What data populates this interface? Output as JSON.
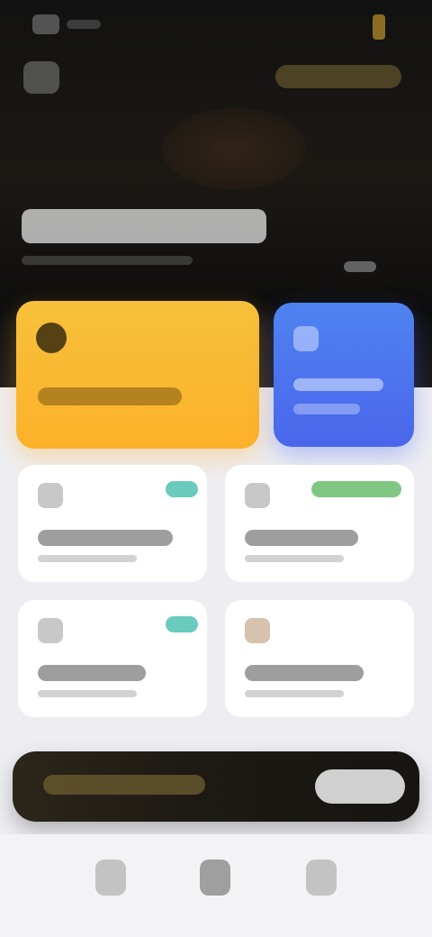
{
  "status_bar": {
    "accent": "#8a6d22"
  },
  "header": {
    "left_icon": "grid-icon",
    "right_pill_color": "#6a5a2e"
  },
  "hero": {
    "title_color": "#d6d6d6",
    "link_color": "#777777"
  },
  "cards": {
    "primary": {
      "color": "#fdb12a",
      "icon": "circle-icon"
    },
    "secondary": {
      "color": "#4a66ec",
      "icon": "square-icon"
    }
  },
  "tiles": [
    {
      "icon": "tile-icon",
      "badge_color": "#2bb3a3"
    },
    {
      "icon": "tile-icon",
      "badge_color": "#4caf50"
    },
    {
      "icon": "tile-icon",
      "badge_color": "#2bb3a3"
    },
    {
      "icon": "tile-icon",
      "badge_color": ""
    }
  ],
  "banner": {
    "button_color": "#d0d0d0"
  },
  "nav": [
    {
      "icon": "home-icon"
    },
    {
      "icon": "center-icon"
    },
    {
      "icon": "profile-icon"
    }
  ]
}
